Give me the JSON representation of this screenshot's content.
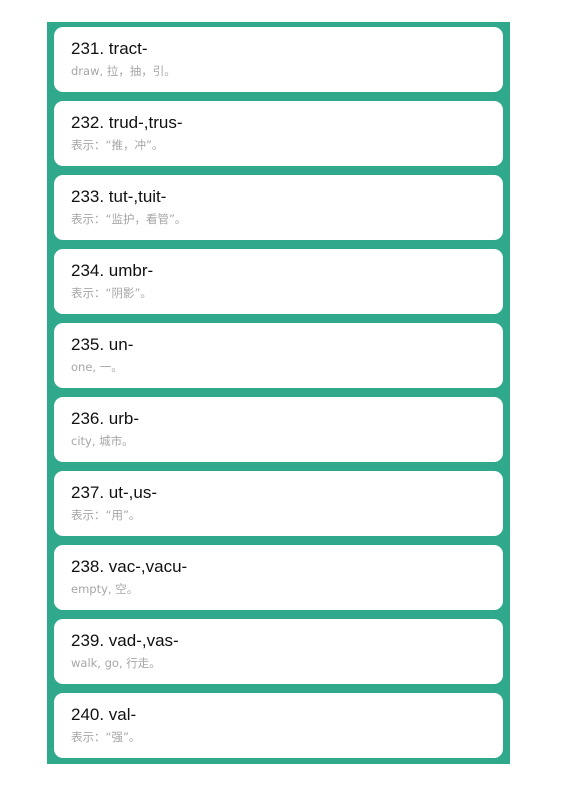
{
  "items": [
    {
      "title": "231. tract-",
      "desc": "draw, 拉，抽，引。"
    },
    {
      "title": "232. trud-,trus-",
      "desc": "表示：“推，冲”。"
    },
    {
      "title": "233. tut-,tuit-",
      "desc": "表示：“监护，看管”。"
    },
    {
      "title": "234. umbr-",
      "desc": "表示：“阴影”。"
    },
    {
      "title": "235. un-",
      "desc": "one, 一。"
    },
    {
      "title": "236. urb-",
      "desc": "city, 城市。"
    },
    {
      "title": "237. ut-,us-",
      "desc": "表示：“用”。"
    },
    {
      "title": "238. vac-,vacu-",
      "desc": "empty, 空。"
    },
    {
      "title": "239. vad-,vas-",
      "desc": "walk, go, 行走。"
    },
    {
      "title": "240. val-",
      "desc": "表示：“强”。"
    }
  ],
  "colors": {
    "panel_background": "#2fa88c",
    "card_background": "#ffffff",
    "title_text": "#111111",
    "description_text": "#a6a6a6"
  }
}
